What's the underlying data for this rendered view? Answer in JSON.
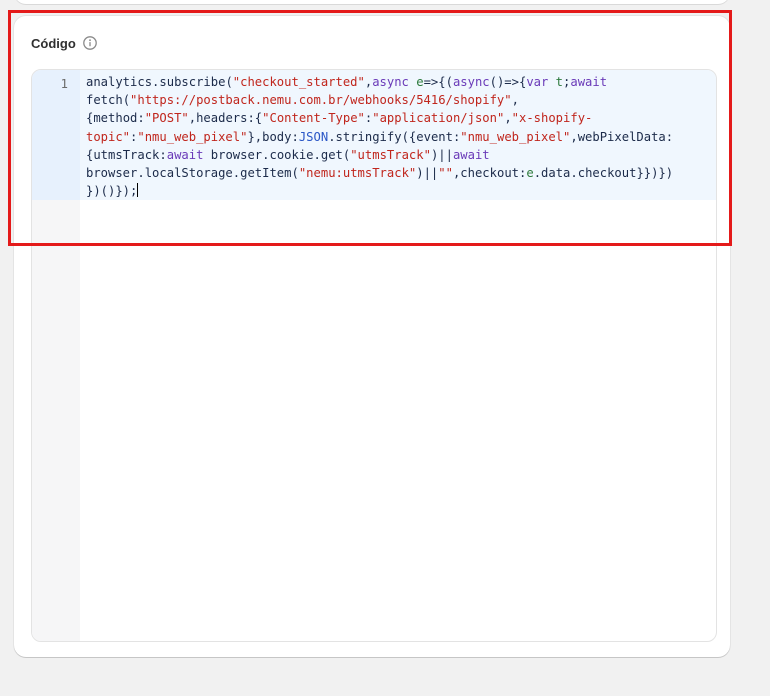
{
  "card": {
    "title": "Código"
  },
  "editor": {
    "line_number": "1",
    "code_lines": [
      [
        {
          "t": "id",
          "v": "analytics"
        },
        {
          "t": "op",
          "v": "."
        },
        {
          "t": "id",
          "v": "subscribe"
        },
        {
          "t": "op",
          "v": "("
        },
        {
          "t": "str",
          "v": "\"checkout_started\""
        },
        {
          "t": "op",
          "v": ","
        },
        {
          "t": "kw",
          "v": "async"
        },
        {
          "t": "op",
          "v": " "
        },
        {
          "t": "def",
          "v": "e"
        },
        {
          "t": "op",
          "v": "=>{("
        },
        {
          "t": "kw",
          "v": "async"
        },
        {
          "t": "op",
          "v": "()=>{"
        },
        {
          "t": "kw",
          "v": "var"
        },
        {
          "t": "op",
          "v": " "
        },
        {
          "t": "def",
          "v": "t"
        },
        {
          "t": "op",
          "v": ";"
        },
        {
          "t": "kw",
          "v": "await"
        }
      ],
      [
        {
          "t": "id",
          "v": "fetch"
        },
        {
          "t": "op",
          "v": "("
        },
        {
          "t": "str",
          "v": "\"https://postback.nemu.com.br/webhooks/5416/shopify\""
        },
        {
          "t": "op",
          "v": ","
        }
      ],
      [
        {
          "t": "op",
          "v": "{"
        },
        {
          "t": "id",
          "v": "method"
        },
        {
          "t": "op",
          "v": ":"
        },
        {
          "t": "str",
          "v": "\"POST\""
        },
        {
          "t": "op",
          "v": ","
        },
        {
          "t": "id",
          "v": "headers"
        },
        {
          "t": "op",
          "v": ":{"
        },
        {
          "t": "str",
          "v": "\"Content-Type\""
        },
        {
          "t": "op",
          "v": ":"
        },
        {
          "t": "str",
          "v": "\"application/json\""
        },
        {
          "t": "op",
          "v": ","
        },
        {
          "t": "str",
          "v": "\"x-shopify-"
        }
      ],
      [
        {
          "t": "str",
          "v": "topic\""
        },
        {
          "t": "op",
          "v": ":"
        },
        {
          "t": "str",
          "v": "\"nmu_web_pixel\""
        },
        {
          "t": "op",
          "v": "},"
        },
        {
          "t": "id",
          "v": "body"
        },
        {
          "t": "op",
          "v": ":"
        },
        {
          "t": "glob",
          "v": "JSON"
        },
        {
          "t": "op",
          "v": "."
        },
        {
          "t": "id",
          "v": "stringify"
        },
        {
          "t": "op",
          "v": "({"
        },
        {
          "t": "id",
          "v": "event"
        },
        {
          "t": "op",
          "v": ":"
        },
        {
          "t": "str",
          "v": "\"nmu_web_pixel\""
        },
        {
          "t": "op",
          "v": ","
        },
        {
          "t": "id",
          "v": "webPixelData"
        },
        {
          "t": "op",
          "v": ":"
        }
      ],
      [
        {
          "t": "op",
          "v": "{"
        },
        {
          "t": "id",
          "v": "utmsTrack"
        },
        {
          "t": "op",
          "v": ":"
        },
        {
          "t": "kw",
          "v": "await"
        },
        {
          "t": "op",
          "v": " "
        },
        {
          "t": "id",
          "v": "browser"
        },
        {
          "t": "op",
          "v": "."
        },
        {
          "t": "id",
          "v": "cookie"
        },
        {
          "t": "op",
          "v": "."
        },
        {
          "t": "id",
          "v": "get"
        },
        {
          "t": "op",
          "v": "("
        },
        {
          "t": "str",
          "v": "\"utmsTrack\""
        },
        {
          "t": "op",
          "v": ")||"
        },
        {
          "t": "kw",
          "v": "await"
        }
      ],
      [
        {
          "t": "id",
          "v": "browser"
        },
        {
          "t": "op",
          "v": "."
        },
        {
          "t": "id",
          "v": "localStorage"
        },
        {
          "t": "op",
          "v": "."
        },
        {
          "t": "id",
          "v": "getItem"
        },
        {
          "t": "op",
          "v": "("
        },
        {
          "t": "str",
          "v": "\"nemu:utmsTrack\""
        },
        {
          "t": "op",
          "v": ")||"
        },
        {
          "t": "str",
          "v": "\"\""
        },
        {
          "t": "op",
          "v": ","
        },
        {
          "t": "id",
          "v": "checkout"
        },
        {
          "t": "op",
          "v": ":"
        },
        {
          "t": "def",
          "v": "e"
        },
        {
          "t": "op",
          "v": "."
        },
        {
          "t": "id",
          "v": "data"
        },
        {
          "t": "op",
          "v": "."
        },
        {
          "t": "id",
          "v": "checkout"
        },
        {
          "t": "op",
          "v": "}})})"
        }
      ],
      [
        {
          "t": "op",
          "v": "})()});"
        }
      ]
    ]
  },
  "colors": {
    "highlight_border": "#e41a1a",
    "string": "#c0261d",
    "keyword": "#6a3ab8",
    "active_line": "#f0f7fe"
  },
  "icons": {
    "info": "info-circle-icon"
  }
}
